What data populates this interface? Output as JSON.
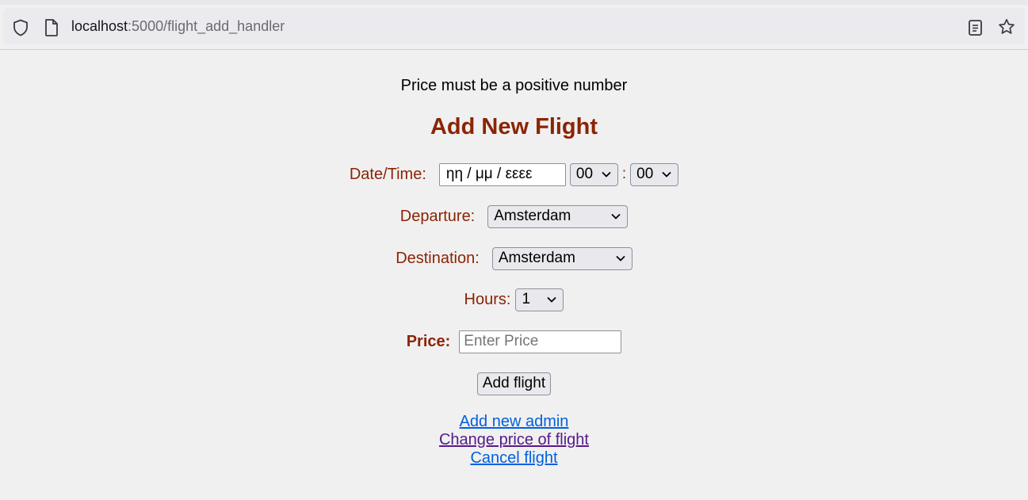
{
  "browser": {
    "url_host": "localhost",
    "url_rest": ":5000/flight_add_handler",
    "icons": [
      "shield-icon",
      "page-icon",
      "reader-view-icon",
      "bookmark-star-icon"
    ]
  },
  "message": "Price must be a positive number",
  "form": {
    "title": "Add New Flight",
    "datetime_label": "Date/Time:",
    "date_value": "ηη / μμ / εεεε",
    "hour_value": "00",
    "time_sep": ":",
    "minute_value": "00",
    "departure_label": "Departure:",
    "departure_value": "Amsterdam",
    "destination_label": "Destination:",
    "destination_value": "Amsterdam",
    "hours_label": "Hours:",
    "hours_value": "1",
    "price_label": "Price:",
    "price_placeholder": "Enter Price",
    "submit_label": "Add flight"
  },
  "links": {
    "add_admin": "Add new admin",
    "change_price": "Change price of flight",
    "cancel_flight": "Cancel flight"
  },
  "colors": {
    "accent": "#8b2406",
    "link": "#0060df",
    "link_visited": "#551a8b",
    "background": "#f0f0f0"
  }
}
